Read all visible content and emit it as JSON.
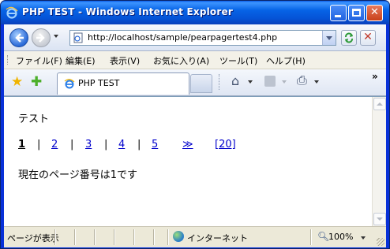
{
  "window": {
    "title": "PHP TEST - Windows Internet Explorer"
  },
  "address": {
    "url": "http://localhost/sample/pearpagertest4.php"
  },
  "menu": {
    "items": [
      "ファイル(F)",
      "編集(E)",
      "表示(V)",
      "お気に入り(A)",
      "ツール(T)",
      "ヘルプ(H)"
    ]
  },
  "tab": {
    "label": "PHP TEST"
  },
  "page": {
    "heading": "テスト",
    "pager": {
      "current": "1",
      "links": [
        "2",
        "3",
        "4",
        "5"
      ],
      "separator": "|",
      "next": "≫",
      "last": "[20]"
    },
    "message": "現在のページ番号は1です"
  },
  "status": {
    "text": "ページが表示",
    "zone": "インターネット",
    "zoom": "100%"
  },
  "colors": {
    "titlebar": "#0553d6",
    "link": "#0000cc"
  },
  "icons": {
    "title": "ie-logo-icon",
    "back": "back-arrow-icon",
    "forward": "forward-arrow-icon",
    "page": "page-icon",
    "refresh": "refresh-icon",
    "stop": "stop-icon",
    "favorites": "favorites-star-icon",
    "add_favorites": "add-favorites-icon",
    "home": "home-icon",
    "feeds": "feeds-icon",
    "print": "print-icon",
    "zone": "globe-icon",
    "zoom": "zoom-icon"
  }
}
